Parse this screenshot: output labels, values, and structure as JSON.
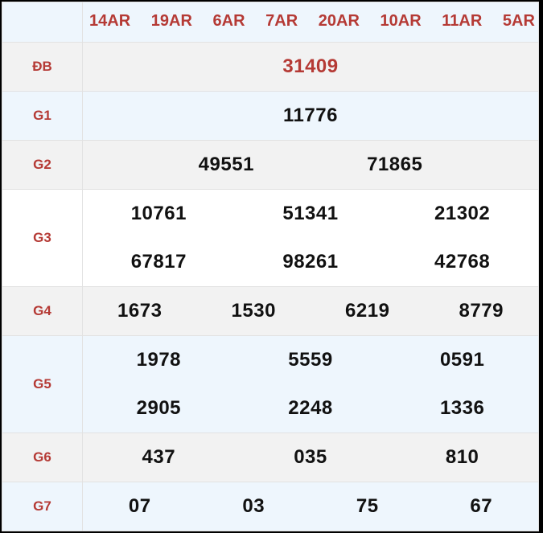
{
  "header": {
    "codes": [
      "14AR",
      "19AR",
      "6AR",
      "7AR",
      "20AR",
      "10AR",
      "11AR",
      "5AR"
    ]
  },
  "prizes": {
    "db": {
      "label": "ĐB",
      "numbers": [
        "31409"
      ]
    },
    "g1": {
      "label": "G1",
      "numbers": [
        "11776"
      ]
    },
    "g2": {
      "label": "G2",
      "numbers": [
        "49551",
        "71865"
      ]
    },
    "g3": {
      "label": "G3",
      "numbers": [
        "10761",
        "51341",
        "21302",
        "67817",
        "98261",
        "42768"
      ]
    },
    "g4": {
      "label": "G4",
      "numbers": [
        "1673",
        "1530",
        "6219",
        "8779"
      ]
    },
    "g5": {
      "label": "G5",
      "numbers": [
        "1978",
        "5559",
        "0591",
        "2905",
        "2248",
        "1336"
      ]
    },
    "g6": {
      "label": "G6",
      "numbers": [
        "437",
        "035",
        "810"
      ]
    },
    "g7": {
      "label": "G7",
      "numbers": [
        "07",
        "03",
        "75",
        "67"
      ]
    }
  },
  "colors": {
    "accent": "#b53a35",
    "row_blue": "#eef6fd",
    "row_gray": "#f2f2f2"
  }
}
